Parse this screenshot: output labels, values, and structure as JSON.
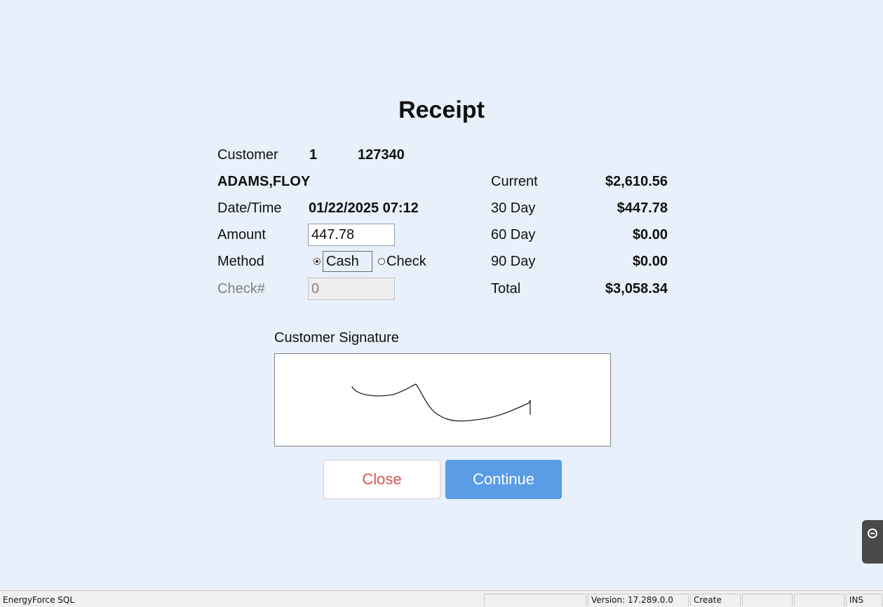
{
  "receipt": {
    "title": "Receipt",
    "customer_label": "Customer",
    "customer_code": "1",
    "customer_number": "127340",
    "customer_name": "ADAMS,FLOY",
    "datetime_label": "Date/Time",
    "datetime_value": "01/22/2025 07:12",
    "amount_label": "Amount",
    "amount_value": "447.78",
    "method_label": "Method",
    "method_options": [
      "Cash",
      "Check"
    ],
    "method_selected": "Cash",
    "checknum_label": "Check#",
    "checknum_value": "0"
  },
  "aging": [
    {
      "label": "Current",
      "value": "$2,610.56"
    },
    {
      "label": "30 Day",
      "value": "$447.78"
    },
    {
      "label": "60 Day",
      "value": "$0.00"
    },
    {
      "label": "90 Day",
      "value": "$0.00"
    },
    {
      "label": "Total",
      "value": "$3,058.34"
    }
  ],
  "signature": {
    "label": "Customer Signature"
  },
  "buttons": {
    "close": "Close",
    "continue": "Continue"
  },
  "statusbar": {
    "app_name": "EnergyForce SQL",
    "cells": [
      "",
      "Version: 17.289.0.0",
      "Create",
      "",
      "",
      "",
      "INS"
    ]
  },
  "icons": {
    "side_tab": "minus-circle-icon"
  },
  "colors": {
    "background": "#e8f0fb",
    "close_text": "#d9534f",
    "continue_bg": "#5a9ce6"
  }
}
